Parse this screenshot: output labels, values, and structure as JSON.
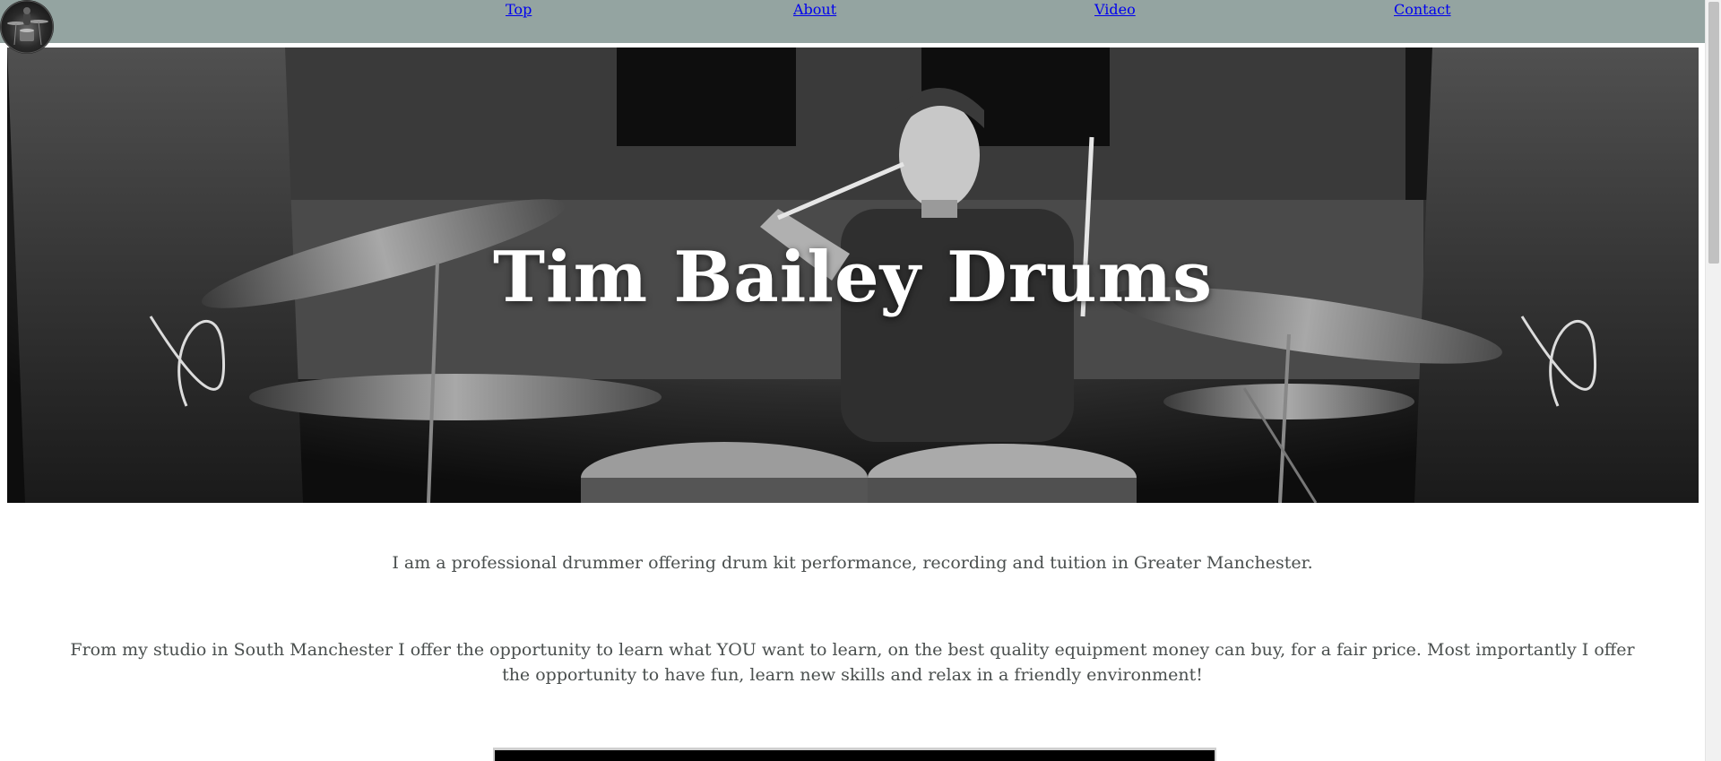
{
  "nav": {
    "links": [
      {
        "label": "Top"
      },
      {
        "label": "About"
      },
      {
        "label": "Video"
      },
      {
        "label": "Contact"
      }
    ],
    "logo_icon": "drum-kit-logo-icon"
  },
  "hero": {
    "title": "Tim Bailey Drums",
    "image": "drummer-photo"
  },
  "content": {
    "intro": "I am a professional drummer offering drum kit performance, recording and tuition in Greater Manchester.",
    "studio": "From my studio in South Manchester I offer the opportunity to learn what YOU want to learn, on the best quality equipment money can buy, for a fair price. Most importantly I offer the opportunity to have fun, learn new skills and relax in a friendly environment!"
  },
  "colors": {
    "navbar": "#94a4a1",
    "link": "#0000ee",
    "body_text": "#4a4f4e",
    "hero_text": "#ffffff"
  }
}
